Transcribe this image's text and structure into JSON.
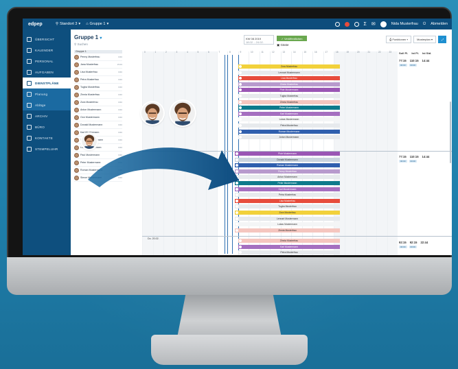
{
  "topbar": {
    "logo": "edpep",
    "location": "Standort 3",
    "group": "Gruppe 1",
    "user": "Nida Musterfrau",
    "logout": "Abmelden"
  },
  "sidebar": {
    "items": [
      {
        "label": "ÜBERSICHT",
        "icon": "home-icon"
      },
      {
        "label": "KALENDER",
        "icon": "calendar-icon"
      },
      {
        "label": "PERSONAL",
        "icon": "people-icon"
      },
      {
        "label": "AUFGABEN",
        "icon": "tasks-icon"
      },
      {
        "label": "DIENSTPLÄNE",
        "icon": "schedule-icon",
        "active": true
      },
      {
        "label": "Planung",
        "icon": "planning-icon",
        "sub": true
      },
      {
        "label": "Abläge",
        "icon": "layers-icon",
        "sub": true
      },
      {
        "label": "ARCHIV",
        "icon": "archive-icon"
      },
      {
        "label": "BÜRO",
        "icon": "office-icon"
      },
      {
        "label": "KONTAKTE",
        "icon": "contacts-icon"
      },
      {
        "label": "STEMPELUHR",
        "icon": "clock-icon"
      }
    ]
  },
  "main": {
    "title": "Gruppe 1",
    "search": "Suchen",
    "week": "KW 08 2019",
    "week_sub": "18.02. - 24.02.",
    "approve": "Veröffentlichen",
    "guests": "Gäste",
    "function_btn": "Funktionen",
    "template_btn": "Musterplan"
  },
  "employees": [
    {
      "name": "Penny Musterfrau",
      "num": "0/40"
    },
    {
      "name": "Jana Musterfrau",
      "num": "15/19"
    },
    {
      "name": "Lisa Musterfrau",
      "num": "0/40"
    },
    {
      "name": "Petra Musterfrau",
      "num": "0/40"
    },
    {
      "name": "Tugba Musterfrau",
      "num": "0/40"
    },
    {
      "name": "Zinnia Musterfrau",
      "num": "0/40"
    },
    {
      "name": "Zora Musterfrau",
      "num": "0/40"
    },
    {
      "name": "Anton Mustermann",
      "num": "0/40"
    },
    {
      "name": "Oon Mustermann",
      "num": "0/40"
    },
    {
      "name": "Donald Mustermann",
      "num": "0/40"
    },
    {
      "name": "Karl Mustermann",
      "num": "0/40"
    },
    {
      "name": "Lennart Mustermann",
      "num": "0/40"
    },
    {
      "name": "Lukas Mustermann",
      "num": "0/40"
    },
    {
      "name": "Paul Mustermann",
      "num": "0/40"
    },
    {
      "name": "Peter Mustermann",
      "num": "0/40"
    },
    {
      "name": "Roman Mustermann",
      "num": "0/40"
    },
    {
      "name": "Simon Mustermann",
      "num": "0/40"
    }
  ],
  "hours": [
    "0",
    "1",
    "2",
    "3",
    "4",
    "5",
    "6",
    "7",
    "8",
    "9",
    "10",
    "11",
    "12",
    "13",
    "14",
    "15",
    "16",
    "17",
    "18",
    "19",
    "20",
    "21",
    "22",
    "23"
  ],
  "stats_head": [
    "Soll Pl.",
    "Ist Pl.",
    "Ist Std."
  ],
  "block1": {
    "bars": [
      {
        "label": "Zora Musterfrau",
        "color": "#f2d13b",
        "text": "#333"
      },
      {
        "label": "Lennart Mustermann",
        "color": "#e7eaed",
        "text": "#333"
      },
      {
        "label": "Lisa Musterfrau",
        "color": "#e74c3c",
        "text": "#fff"
      },
      {
        "label": "Zinnia Musterfrau",
        "color": "#b89acd",
        "text": "#fff"
      },
      {
        "label": "Piotr Mustermann",
        "color": "#9a56b4",
        "text": "#fff"
      },
      {
        "label": "Tugba Musterfrau",
        "color": "#e7eaed",
        "text": "#333"
      },
      {
        "label": "Zinnia Musterfrau",
        "color": "#f5c6bf",
        "text": "#333"
      },
      {
        "label": "Peter Mustermann",
        "color": "#0e7a8c",
        "text": "#fff"
      },
      {
        "label": "Karl Mustermann",
        "color": "#a56fc0",
        "text": "#fff"
      },
      {
        "label": "Lukas Mustermann",
        "color": "#f4f5f6",
        "text": "#333"
      },
      {
        "label": "Petra Musterfrau",
        "color": "#e7eaed",
        "text": "#333"
      },
      {
        "label": "Roman Mustermann",
        "color": "#2f5fae",
        "text": "#fff"
      },
      {
        "label": "Anton Mustermann",
        "color": "#e7eaed",
        "text": "#333"
      }
    ],
    "stats": {
      "soll": "77:15",
      "ist": "110:15",
      "std": "14:44",
      "chip1": "00:00",
      "chip2": "00:00"
    }
  },
  "block2": {
    "bars": [
      {
        "label": "Piotr Mustermann",
        "color": "#9a56b4",
        "text": "#fff"
      },
      {
        "label": "Donald Mustermann",
        "color": "#c9d4de",
        "text": "#333"
      },
      {
        "label": "Roman Mustermann",
        "color": "#2f5fae",
        "text": "#fff"
      },
      {
        "label": "Penny Musterfrau",
        "color": "#b89acd",
        "text": "#fff"
      },
      {
        "label": "Anton Mustermann",
        "color": "#e7eaed",
        "text": "#333"
      },
      {
        "label": "Peter Mustermann",
        "color": "#0e7a8c",
        "text": "#fff"
      },
      {
        "label": "Karl Mustermann",
        "color": "#a56fc0",
        "text": "#fff"
      },
      {
        "label": "Petra Musterfrau",
        "color": "#e7eaed",
        "text": "#333"
      },
      {
        "label": "Lisa Musterfrau",
        "color": "#e74c3c",
        "text": "#fff"
      },
      {
        "label": "Tugba Musterfrau",
        "color": "#e7eaed",
        "text": "#333"
      },
      {
        "label": "Zora Musterfrau",
        "color": "#f2d13b",
        "text": "#333"
      },
      {
        "label": "Lennart Mustermann",
        "color": "#e7eaed",
        "text": "#333"
      },
      {
        "label": "Lukas Mustermann",
        "color": "#f4f5f6",
        "text": "#333"
      },
      {
        "label": "Zinnia Musterfrau",
        "color": "#f5c6bf",
        "text": "#333"
      }
    ],
    "stats": {
      "soll": "77:15",
      "ist": "110:15",
      "std": "14:44",
      "chip1": "00:00",
      "chip2": "00:00"
    }
  },
  "block3": {
    "date": "Do. 20.02.",
    "bars": [
      {
        "label": "Zinnia Musterfrau",
        "color": "#f5c6bf",
        "text": "#333"
      },
      {
        "label": "Karl Mustermann",
        "color": "#a56fc0",
        "text": "#fff"
      },
      {
        "label": "Petra Musterfrau",
        "color": "#e7eaed",
        "text": "#333"
      }
    ],
    "stats": {
      "soll": "92:15",
      "ist": "92:15",
      "std": "22:44",
      "chip1": "00:00",
      "chip2": "00:00"
    }
  },
  "colors": {
    "accent": "#0e4f7e",
    "arrow": "#1b6aa1",
    "bg": "#2a8fb8"
  }
}
